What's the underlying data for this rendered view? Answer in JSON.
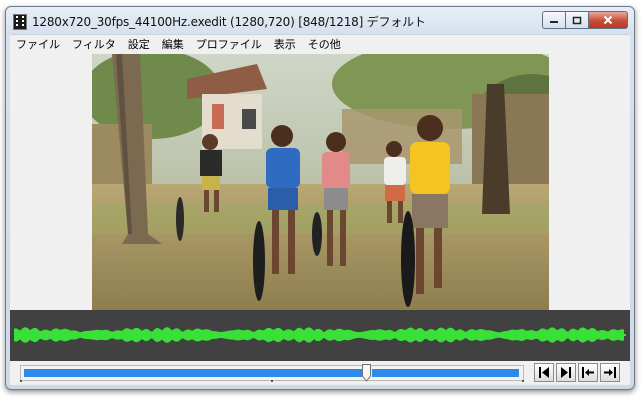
{
  "window": {
    "title": "1280x720_30fps_44100Hz.exedit (1280,720)  [848/1218]  デフォルト",
    "controls": {
      "minimize_label": "▭",
      "maximize_label": "□",
      "close_label": "✕"
    }
  },
  "menu": {
    "items": [
      {
        "id": "file",
        "label": "ファイル"
      },
      {
        "id": "filter",
        "label": "フィルタ"
      },
      {
        "id": "settings",
        "label": "設定"
      },
      {
        "id": "edit",
        "label": "編集"
      },
      {
        "id": "profile",
        "label": "プロファイル"
      },
      {
        "id": "view",
        "label": "表示"
      },
      {
        "id": "other",
        "label": "その他"
      }
    ]
  },
  "timeline": {
    "current_frame": 848,
    "total_frames": 1218,
    "position_fraction": 0.696
  },
  "buttons": {
    "prev_frame": "prev-frame",
    "next_frame": "next-frame",
    "go_start": "go-start",
    "go_end": "go-end"
  },
  "colors": {
    "waveform": "#38e038",
    "waveform_bg": "#414141",
    "seekbar_fill": "#2e8ae6",
    "close_button": "#c74c35"
  }
}
